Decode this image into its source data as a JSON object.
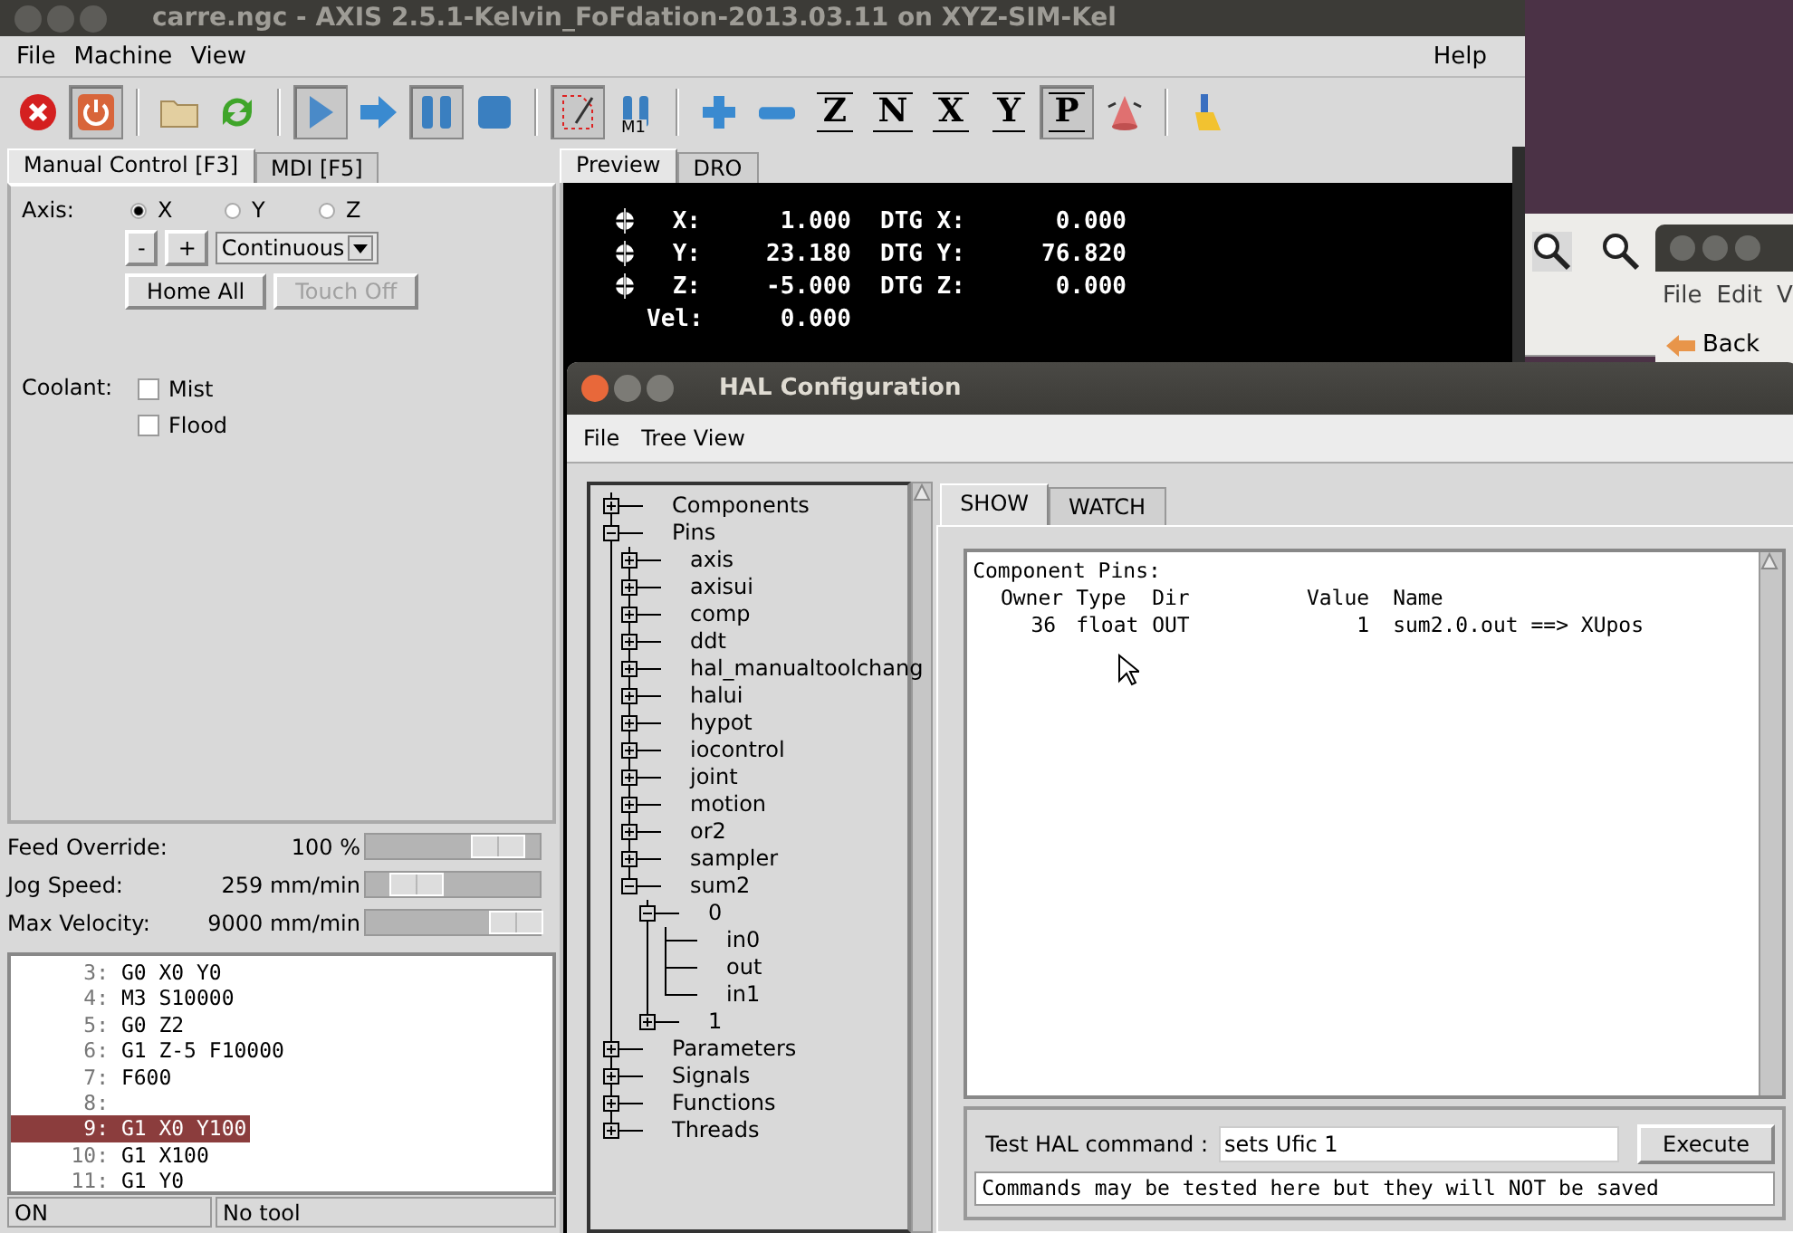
{
  "axis_window": {
    "title": "carre.ngc - AXIS 2.5.1-Kelvin_FoFdation-2013.03.11 on XYZ-SIM-Kel",
    "menu": [
      "File",
      "Machine",
      "View"
    ],
    "help_menu": "Help",
    "toolbar": [
      {
        "kind": "estop",
        "pressed": false
      },
      {
        "kind": "power",
        "pressed": true
      },
      {
        "kind": "separator"
      },
      {
        "kind": "open",
        "pressed": false
      },
      {
        "kind": "reload",
        "pressed": false
      },
      {
        "kind": "separator"
      },
      {
        "kind": "run",
        "pressed": true
      },
      {
        "kind": "step",
        "pressed": false
      },
      {
        "kind": "pause",
        "pressed": true
      },
      {
        "kind": "stop",
        "pressed": false
      },
      {
        "kind": "separator"
      },
      {
        "kind": "block_delete",
        "pressed": true
      },
      {
        "kind": "optional_stop",
        "pressed": false,
        "label": "M1"
      },
      {
        "kind": "separator"
      },
      {
        "kind": "zoom_in",
        "pressed": false
      },
      {
        "kind": "zoom_out",
        "pressed": false
      },
      {
        "kind": "view",
        "pressed": false,
        "label": "Z"
      },
      {
        "kind": "view",
        "pressed": false,
        "label": "N"
      },
      {
        "kind": "view",
        "pressed": false,
        "label": "X"
      },
      {
        "kind": "view",
        "pressed": false,
        "label": "Y"
      },
      {
        "kind": "view",
        "pressed": true,
        "label": "P"
      },
      {
        "kind": "rotate",
        "pressed": false
      },
      {
        "kind": "separator"
      },
      {
        "kind": "clear",
        "pressed": false
      }
    ],
    "left_tabs": [
      {
        "label": "Manual Control [F3]",
        "selected": true
      },
      {
        "label": "MDI [F5]",
        "selected": false
      }
    ],
    "manual": {
      "axis_label": "Axis:",
      "axes": [
        {
          "label": "X",
          "selected": true
        },
        {
          "label": "Y",
          "selected": false
        },
        {
          "label": "Z",
          "selected": false
        }
      ],
      "jog_minus": "-",
      "jog_plus": "+",
      "increment": "Continuous",
      "home_button": {
        "label": "Home All",
        "disabled": false
      },
      "touch_off_button": {
        "label": "Touch Off",
        "disabled": true
      },
      "coolant_label": "Coolant:",
      "coolant": [
        {
          "label": "Mist",
          "checked": false
        },
        {
          "label": "Flood",
          "checked": false
        }
      ]
    },
    "sliders": [
      {
        "label": "Feed Override:",
        "reading": "100 %",
        "level": 0.85
      },
      {
        "label": "Jog Speed:",
        "reading": "259 mm/min",
        "level": 0.19
      },
      {
        "label": "Max Velocity:",
        "reading": "9000 mm/min",
        "level": 1
      }
    ],
    "gcode": [
      {
        "number": "3:",
        "code": "G0 X0 Y0",
        "selected": false
      },
      {
        "number": "4:",
        "code": "M3 S10000",
        "selected": false
      },
      {
        "number": "5:",
        "code": "G0 Z2",
        "selected": false
      },
      {
        "number": "6:",
        "code": "G1 Z-5 F10000",
        "selected": false
      },
      {
        "number": "7:",
        "code": "F600",
        "selected": false
      },
      {
        "number": "8:",
        "selected": false
      },
      {
        "number": "9:",
        "code": "G1 X0 Y100",
        "selected": true
      },
      {
        "number": "10:",
        "code": "G1 X100",
        "selected": false
      },
      {
        "number": "11:",
        "code": "G1 Y0",
        "selected": false
      }
    ],
    "status_bar": [
      "ON",
      "No tool"
    ],
    "preview_tabs": [
      {
        "label": "Preview",
        "selected": true
      },
      {
        "label": "DRO",
        "selected": false
      }
    ],
    "dro": [
      {
        "homed": true,
        "axis": "X:",
        "value": "1.000",
        "dtg_label": "DTG X:",
        "dtg": "0.000"
      },
      {
        "homed": true,
        "axis": "Y:",
        "value": "23.180",
        "dtg_label": "DTG Y:",
        "dtg": "76.820"
      },
      {
        "homed": true,
        "axis": "Z:",
        "value": "-5.000",
        "dtg_label": "DTG Z:",
        "dtg": "0.000"
      },
      {
        "homed": false,
        "axis": "Vel:",
        "value": "0.000"
      }
    ]
  },
  "background_window": {
    "menu": [
      "File",
      "Edit",
      "V"
    ],
    "back_button": "Back"
  },
  "hal_window": {
    "title": "HAL Configuration",
    "menu": [
      "File",
      "Tree View"
    ],
    "tree": [
      {
        "label": "Components",
        "expanded": false
      },
      {
        "label": "Pins",
        "expanded": true,
        "children": [
          {
            "label": "axis",
            "expanded": false
          },
          {
            "label": "axisui",
            "expanded": false
          },
          {
            "label": "comp",
            "expanded": false
          },
          {
            "label": "ddt",
            "expanded": false
          },
          {
            "label": "hal_manualtoolchang",
            "expanded": false
          },
          {
            "label": "halui",
            "expanded": false
          },
          {
            "label": "hypot",
            "expanded": false
          },
          {
            "label": "iocontrol",
            "expanded": false
          },
          {
            "label": "joint",
            "expanded": false
          },
          {
            "label": "motion",
            "expanded": false
          },
          {
            "label": "or2",
            "expanded": false
          },
          {
            "label": "sampler",
            "expanded": false
          },
          {
            "label": "sum2",
            "expanded": true,
            "children": [
              {
                "label": "0",
                "expanded": true,
                "children": [
                  {
                    "label": "in0"
                  },
                  {
                    "label": "out"
                  },
                  {
                    "label": "in1"
                  }
                ]
              },
              {
                "label": "1",
                "expanded": false
              }
            ]
          }
        ]
      },
      {
        "label": "Parameters",
        "expanded": false
      },
      {
        "label": "Signals",
        "expanded": false
      },
      {
        "label": "Functions",
        "expanded": false
      },
      {
        "label": "Threads",
        "expanded": false
      }
    ],
    "tabs": [
      {
        "label": "SHOW",
        "selected": true
      },
      {
        "label": "WATCH",
        "selected": false
      }
    ],
    "pins_heading": "Component Pins:",
    "columns": [
      "Owner",
      "Type",
      "Dir",
      "Value",
      "Name"
    ],
    "rows": [
      [
        "36",
        "float",
        "OUT",
        "1",
        "sum2.0.out ==> XUpos"
      ]
    ],
    "command_label": "Test HAL command :",
    "command_value": "sets Ufic 1",
    "execute_button": "Execute",
    "message": "Commands may be tested here but they will NOT be saved"
  }
}
